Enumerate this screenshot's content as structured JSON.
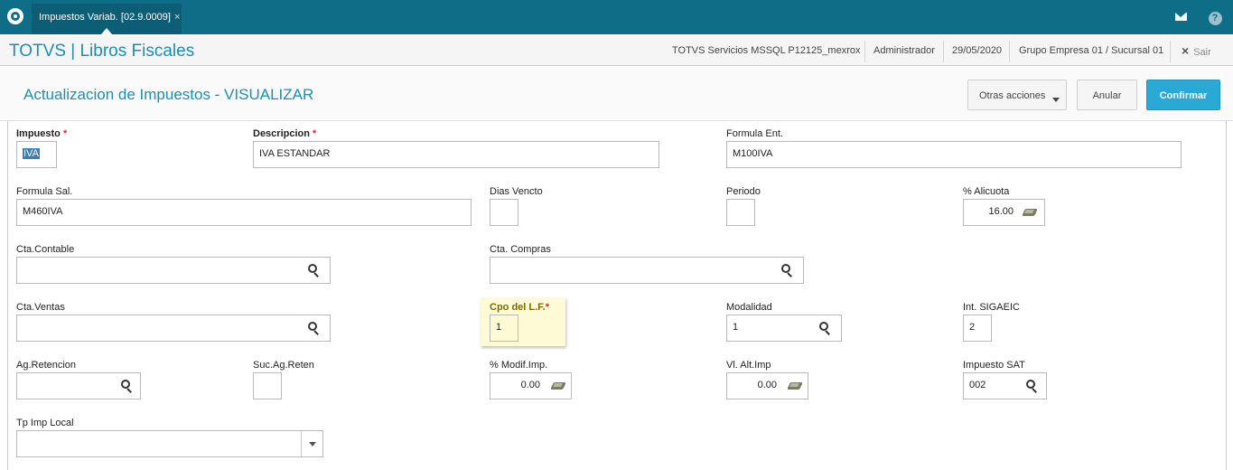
{
  "topbar": {
    "tab_label": "Impuestos Variab. [02.9.0009]",
    "tab_close": "×",
    "help_glyph": "?",
    "icons": [
      "totvs-logo-icon",
      "mail-icon",
      "help-icon"
    ]
  },
  "appbar": {
    "title": "TOTVS | Libros Fiscales",
    "environment": "TOTVS Servicios MSSQL P12125_mexrox",
    "user": "Administrador",
    "date": "29/05/2020",
    "company": "Grupo Empresa 01 / Sucursal 01",
    "exit_glyph": "×",
    "exit_label": "Sair"
  },
  "page": {
    "title": "Actualizacion de Impuestos - VISUALIZAR",
    "other_actions_label": "Otras acciones",
    "cancel_label": "Anular",
    "confirm_label": "Confirmar",
    "confirm_color": "#2aa9d6"
  },
  "form": {
    "required_mark": "*",
    "impuesto": {
      "label": "Impuesto",
      "value": "IVA"
    },
    "descripcion": {
      "label": "Descripcion",
      "value": "IVA ESTANDAR"
    },
    "formula_ent": {
      "label": "Formula Ent.",
      "value": "M100IVA"
    },
    "formula_sal": {
      "label": "Formula Sal.",
      "value": "M460IVA"
    },
    "dias_vencto": {
      "label": "Dias Vencto",
      "value": ""
    },
    "periodo": {
      "label": "Periodo",
      "value": ""
    },
    "alicuota": {
      "label": "% Alicuota",
      "value": "16.00"
    },
    "cta_contable": {
      "label": "Cta.Contable",
      "value": ""
    },
    "cta_compras": {
      "label": "Cta. Compras",
      "value": ""
    },
    "cta_ventas": {
      "label": "Cta.Ventas",
      "value": ""
    },
    "cpo_lf": {
      "label": "Cpo del L.F.",
      "value": "1"
    },
    "modalidad": {
      "label": "Modalidad",
      "value": "1"
    },
    "int_sigaeic": {
      "label": "Int. SIGAEIC",
      "value": "2"
    },
    "ag_retencion": {
      "label": "Ag.Retencion",
      "value": ""
    },
    "suc_ag_reten": {
      "label": "Suc.Ag.Reten",
      "value": ""
    },
    "modif_imp": {
      "label": "% Modif.Imp.",
      "value": "0.00"
    },
    "vl_alt_imp": {
      "label": "Vl. Alt.Imp",
      "value": "0.00"
    },
    "impuesto_sat": {
      "label": "Impuesto SAT",
      "value": "002"
    },
    "tp_imp_local": {
      "label": "Tp Imp Local",
      "value": ""
    }
  }
}
